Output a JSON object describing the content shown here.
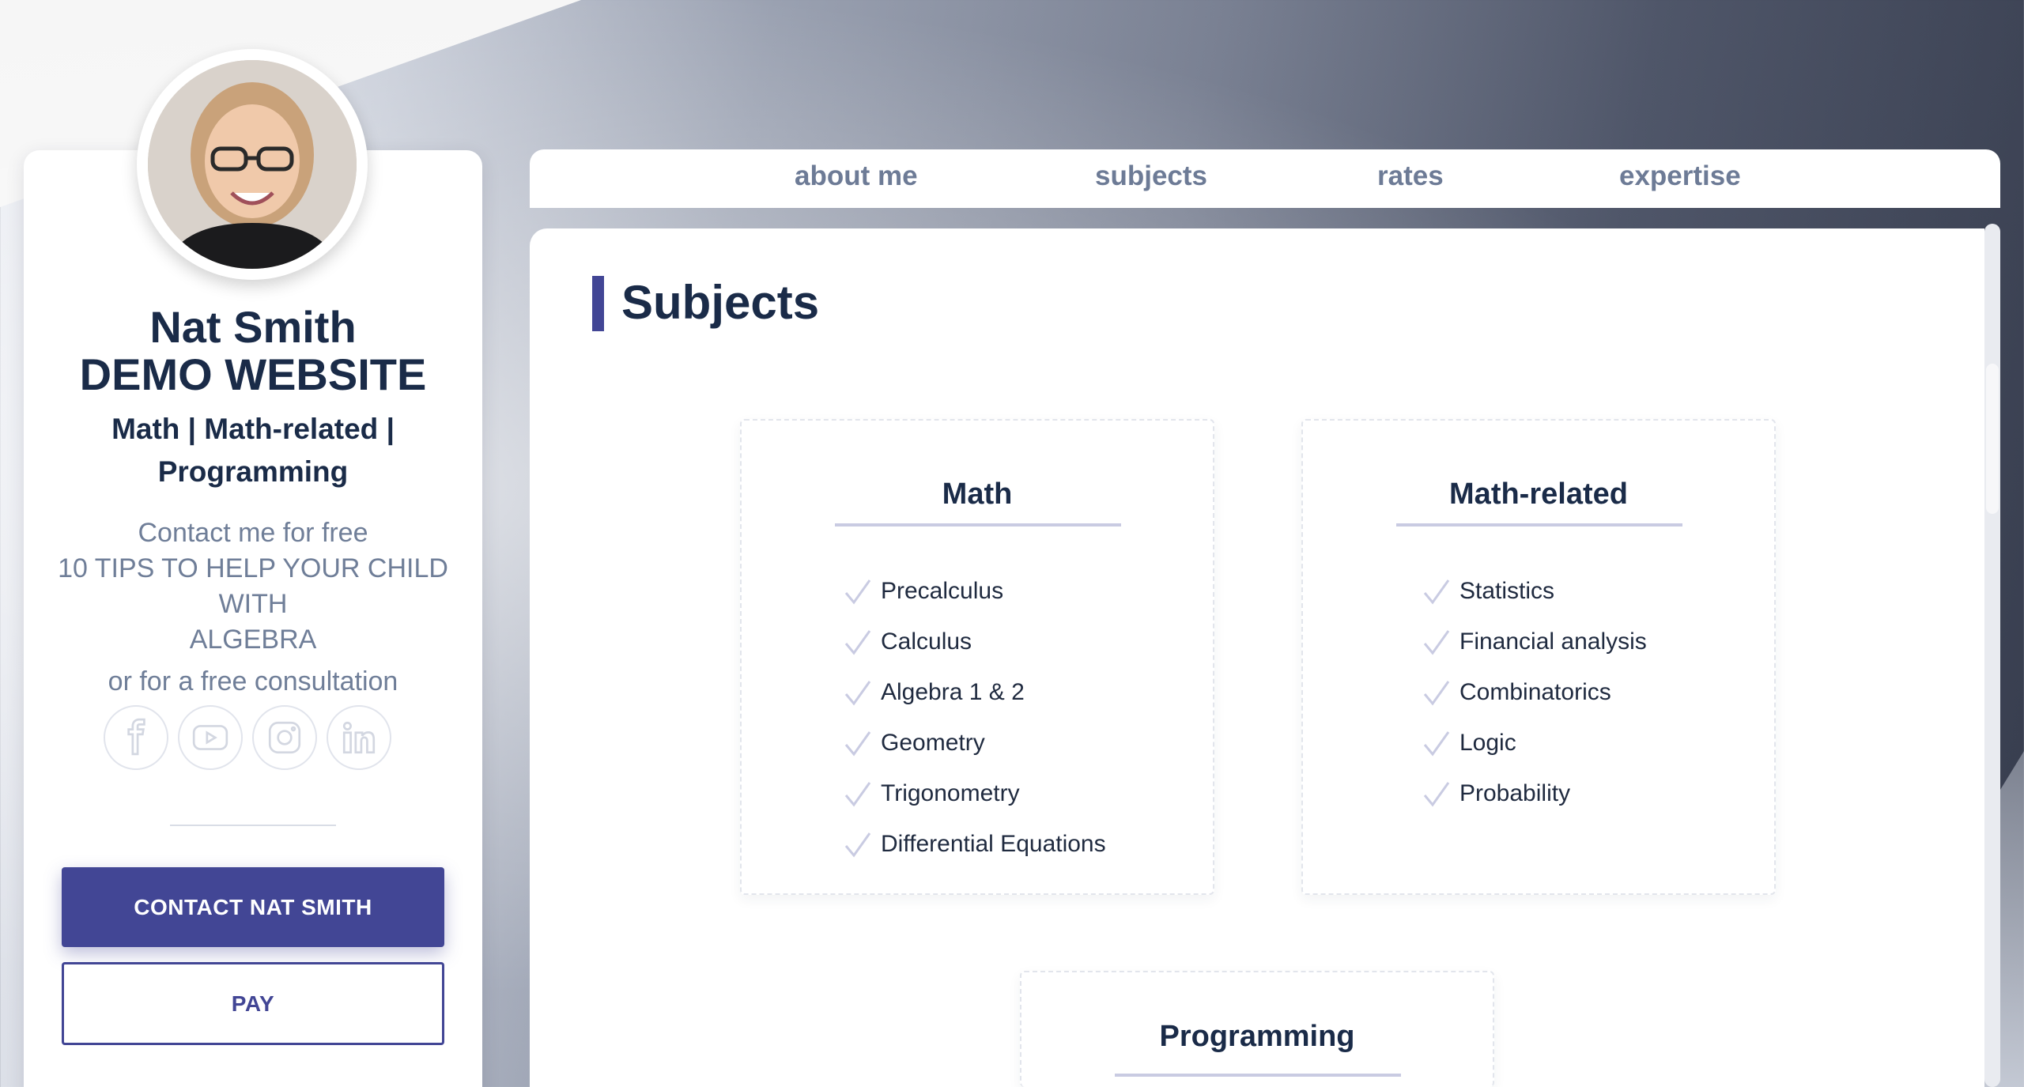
{
  "profile": {
    "name_line1": "Nat Smith",
    "name_line2": "DEMO WEBSITE",
    "subtitle_line1": "Math | Math-related |",
    "subtitle_line2": "Programming",
    "contact_line": "Contact me for free",
    "tips_line1": "10 TIPS TO HELP YOUR CHILD WITH",
    "tips_line2": "ALGEBRA",
    "consult_line": "or for a free consultation",
    "social": [
      {
        "icon": "facebook-icon"
      },
      {
        "icon": "youtube-icon"
      },
      {
        "icon": "instagram-icon"
      },
      {
        "icon": "linkedin-icon"
      }
    ],
    "contact_button": "CONTACT NAT SMITH",
    "pay_button": "PAY"
  },
  "nav": {
    "items": [
      "about me",
      "subjects",
      "rates",
      "expertise"
    ]
  },
  "section": {
    "title": "Subjects"
  },
  "cards": [
    {
      "title": "Math",
      "items": [
        "Precalculus",
        "Calculus",
        "Algebra 1 & 2",
        "Geometry",
        "Trigonometry",
        "Differential Equations"
      ]
    },
    {
      "title": "Math-related",
      "items": [
        "Statistics",
        "Financial analysis",
        "Combinatorics",
        "Logic",
        "Probability"
      ]
    },
    {
      "title": "Programming",
      "items": []
    }
  ],
  "colors": {
    "accent": "#424695",
    "heading": "#1a2b48",
    "muted": "#6f7e98"
  }
}
